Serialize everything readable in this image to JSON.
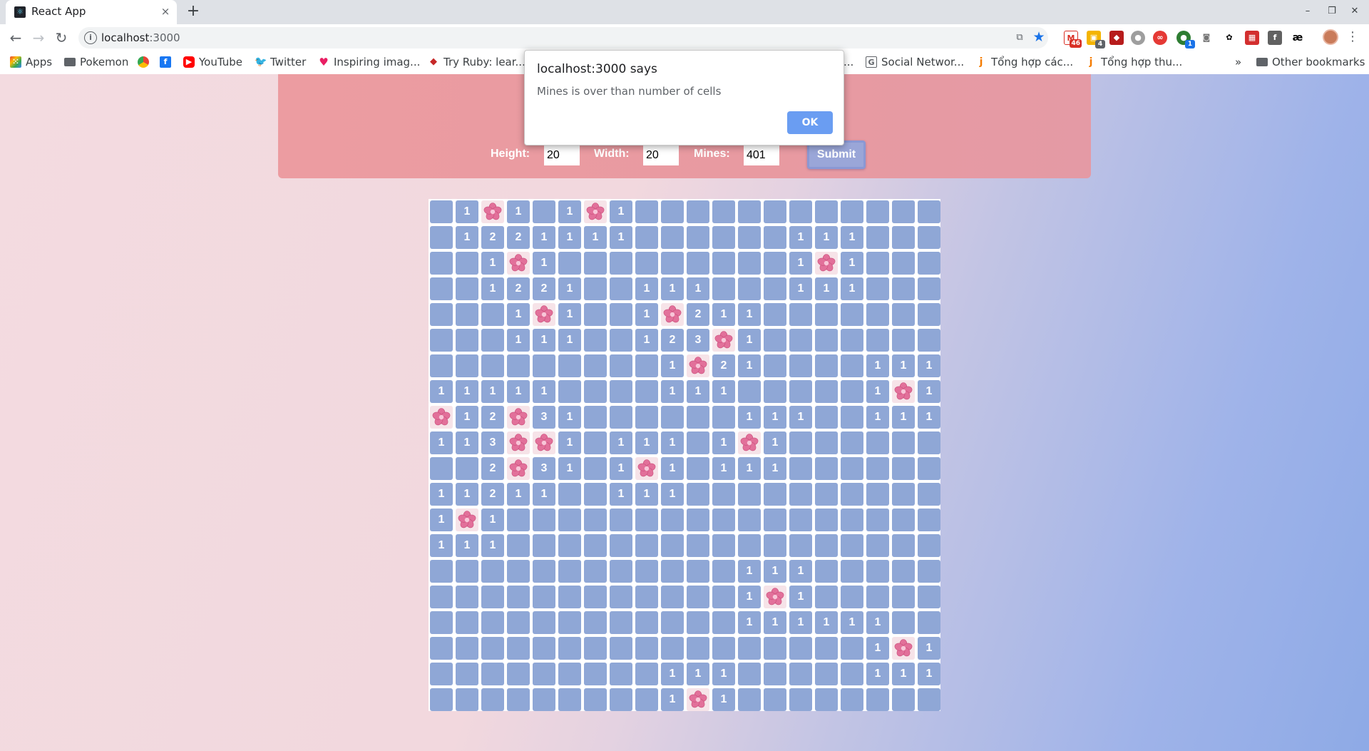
{
  "browser": {
    "tab_title": "React App",
    "tab_close": "×",
    "new_tab": "+",
    "url_host": "localhost",
    "url_port": ":3000",
    "window_controls": [
      "–",
      "❐",
      "✕"
    ],
    "extension_badges": {
      "gmail": "46",
      "notes": "4",
      "green": "1"
    }
  },
  "bookmarks": [
    {
      "label": "Apps",
      "icon": "apps-grid-icon"
    },
    {
      "label": "Pokemon",
      "icon": "folder-icon"
    },
    {
      "label": "",
      "icon": "chrome-icon"
    },
    {
      "label": "",
      "icon": "facebook-icon"
    },
    {
      "label": "YouTube",
      "icon": "youtube-icon"
    },
    {
      "label": "Twitter",
      "icon": "twitter-icon"
    },
    {
      "label": "Inspiring imag...",
      "icon": "heart-icon"
    },
    {
      "label": "Try Ruby: lear...",
      "icon": "ruby-icon"
    },
    {
      "label": "...",
      "icon": ""
    },
    {
      "label": "Social Networ...",
      "icon": "page-icon"
    },
    {
      "label": "Tổng hợp các...",
      "icon": "j-icon"
    },
    {
      "label": "Tổng hợp thu...",
      "icon": "j-icon"
    },
    {
      "label": "»",
      "icon": ""
    },
    {
      "label": "Other bookmarks",
      "icon": "folder-icon"
    }
  ],
  "form": {
    "height_label": "Height:",
    "height_value": "20",
    "width_label": "Width:",
    "width_value": "20",
    "mines_label": "Mines:",
    "mines_value": "401",
    "submit_label": "Submit"
  },
  "dialog": {
    "title": "localhost:3000 says",
    "message": "Mines is over than number of cells",
    "ok_label": "OK"
  },
  "board": {
    "rows": 20,
    "cols": 20,
    "cells": [
      "_1*1_1*1____________",
      "_1221111______111___",
      "__1*1_________1*1___",
      "__1221__111___111___",
      "___1*1__1*211_______",
      "___111__123*1_______",
      "_________1*21____111",
      "11111____111_____1*1",
      "*12*31______111__111",
      "113**1_111_1*1______",
      "__2*31_1*1_111______",
      "11211__111__________",
      "1*1_________________",
      "111_________________",
      "____________111_____",
      "____________1*1_____",
      "____________111111__",
      "_________________1*1__",
      "_________111_____111__",
      "_________1*1________"
    ],
    "colors": {
      "cell": "#8fa7d6",
      "mine_bg": "#f6e3e8",
      "flower": "#e2709a"
    }
  }
}
